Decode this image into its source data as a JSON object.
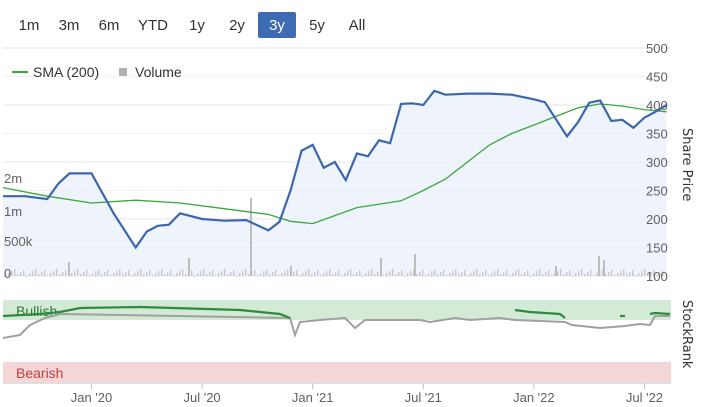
{
  "range_buttons": [
    {
      "label": "1m",
      "active": false
    },
    {
      "label": "3m",
      "active": false
    },
    {
      "label": "6m",
      "active": false
    },
    {
      "label": "YTD",
      "active": false
    },
    {
      "label": "1y",
      "active": false
    },
    {
      "label": "2y",
      "active": false
    },
    {
      "label": "3y",
      "active": true
    },
    {
      "label": "5y",
      "active": false
    },
    {
      "label": "All",
      "active": false
    }
  ],
  "legend": {
    "sma": "SMA (200)",
    "volume": "Volume"
  },
  "labels": {
    "share_price": "Share Price",
    "stockrank": "StockRank",
    "bullish": "Bullish",
    "bearish": "Bearish"
  },
  "colors": {
    "price": "#3a67b0",
    "sma": "#3aa83a",
    "volume": "#c0c0c0",
    "bullish_band": "#d2ead6",
    "bearish_band": "#f5d6d6",
    "rank_bull": "#2e8b3e",
    "rank_gray": "#a0a0a0",
    "active_button": "#3d6cb5"
  },
  "chart_data": {
    "type": "line",
    "x_axis": {
      "ticks": [
        "Jan '20",
        "Jul '20",
        "Jan '21",
        "Jul '21",
        "Jan '22",
        "Jul '22"
      ]
    },
    "y_axis_price": {
      "label": "Share Price",
      "ticks": [
        100,
        150,
        200,
        250,
        300,
        350,
        400,
        450,
        500
      ],
      "range": [
        90,
        500
      ]
    },
    "y_axis_volume": {
      "ticks": [
        "0",
        "500k",
        "1m",
        "2m"
      ]
    },
    "series": [
      {
        "name": "SMA (200)",
        "type": "line",
        "x": [
          2019.6,
          2019.8,
          2020.0,
          2020.2,
          2020.4,
          2020.6,
          2020.8,
          2020.9,
          2021.0,
          2021.2,
          2021.4,
          2021.5,
          2021.6,
          2021.7,
          2021.8,
          2021.9,
          2022.0,
          2022.1,
          2022.2,
          2022.3,
          2022.4,
          2022.5,
          2022.6
        ],
        "values": [
          255,
          240,
          228,
          233,
          228,
          218,
          208,
          196,
          192,
          220,
          232,
          250,
          270,
          300,
          330,
          350,
          365,
          380,
          395,
          402,
          398,
          392,
          388
        ]
      },
      {
        "name": "Price",
        "type": "line",
        "x": [
          2019.6,
          2019.7,
          2019.8,
          2019.85,
          2019.9,
          2020.0,
          2020.1,
          2020.2,
          2020.25,
          2020.3,
          2020.35,
          2020.4,
          2020.5,
          2020.6,
          2020.7,
          2020.8,
          2020.85,
          2020.9,
          2020.95,
          2021.0,
          2021.05,
          2021.1,
          2021.15,
          2021.2,
          2021.25,
          2021.3,
          2021.35,
          2021.4,
          2021.45,
          2021.5,
          2021.55,
          2021.6,
          2021.7,
          2021.8,
          2021.9,
          2022.0,
          2022.05,
          2022.1,
          2022.15,
          2022.2,
          2022.25,
          2022.3,
          2022.35,
          2022.4,
          2022.45,
          2022.5,
          2022.55,
          2022.6
        ],
        "values": [
          240,
          240,
          235,
          262,
          280,
          280,
          210,
          150,
          178,
          188,
          190,
          210,
          200,
          197,
          198,
          180,
          195,
          250,
          320,
          330,
          290,
          300,
          268,
          315,
          310,
          338,
          333,
          402,
          403,
          400,
          425,
          418,
          420,
          420,
          418,
          410,
          405,
          375,
          345,
          370,
          404,
          408,
          372,
          374,
          360,
          378,
          388,
          400
        ]
      }
    ]
  }
}
